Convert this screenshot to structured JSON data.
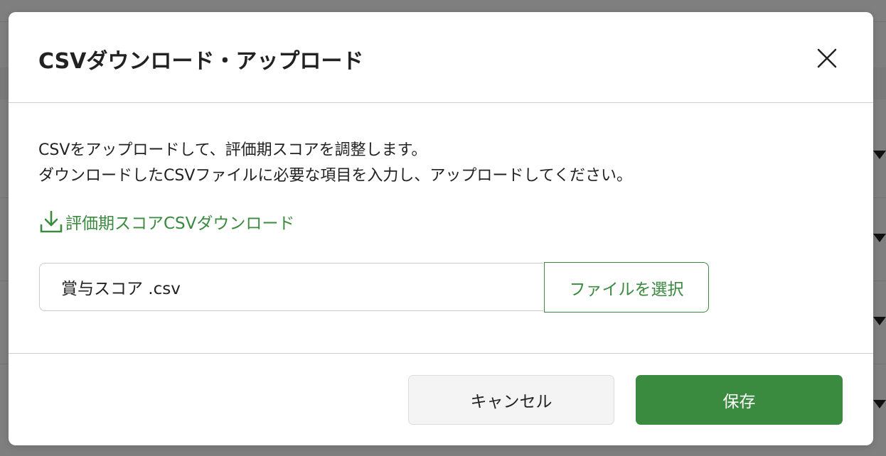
{
  "colors": {
    "accent": "#3a8a3f",
    "overlay": "#7f7f7f",
    "text": "#222222",
    "divider": "#cfcfcf",
    "cancel_bg": "#f4f4f4"
  },
  "dialog": {
    "title": "CSVダウンロード・アップロード",
    "close_icon": "close-icon",
    "description": [
      "CSVをアップロードして、評価期スコアを調整します。",
      "ダウンロードしたCSVファイルに必要な項目を入力し、アップロードしてください。"
    ],
    "download_link": {
      "icon": "download-icon",
      "label": "評価期スコアCSVダウンロード"
    },
    "file_input": {
      "value": "賞与スコア .csv",
      "select_label": "ファイルを選択"
    },
    "footer": {
      "cancel_label": "キャンセル",
      "save_label": "保存"
    }
  }
}
